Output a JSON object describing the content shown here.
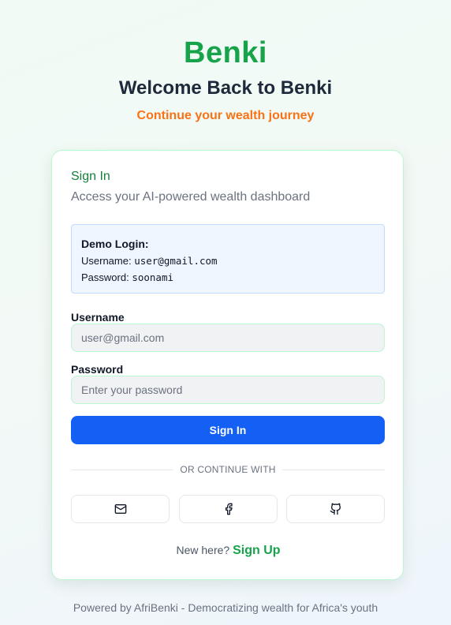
{
  "header": {
    "brand": "Benki",
    "welcome": "Welcome Back to Benki",
    "tagline": "Continue your wealth journey"
  },
  "card": {
    "title": "Sign In",
    "subtitle": "Access your AI-powered wealth dashboard",
    "demo": {
      "title": "Demo Login:",
      "username_label": "Username: ",
      "username_value": "user@gmail.com",
      "password_label": "Password: ",
      "password_value": "soonami"
    },
    "form": {
      "username_label": "Username",
      "username_placeholder": "user@gmail.com",
      "password_label": "Password",
      "password_placeholder": "Enter your password",
      "submit_label": "Sign In"
    },
    "divider_text": "OR CONTINUE WITH",
    "social_buttons": [
      {
        "icon": "mail-icon"
      },
      {
        "icon": "facebook-icon"
      },
      {
        "icon": "github-icon"
      }
    ],
    "signup": {
      "prompt": "New here?",
      "link": "Sign Up"
    }
  },
  "footer": {
    "text": "Powered by AfriBenki - Democratizing wealth for Africa's youth"
  },
  "colors": {
    "brand_green": "#16a34a",
    "tagline_orange": "#f97316",
    "primary_blue": "#1460f5",
    "demo_bg": "#eff6ff"
  }
}
